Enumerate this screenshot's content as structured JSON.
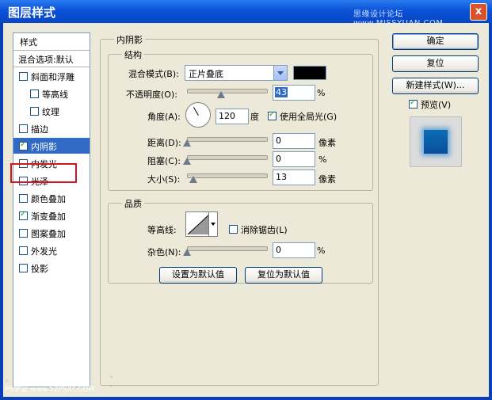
{
  "window": {
    "title": "图层样式",
    "watermark": "思缘设计论坛 www.MISSYUAN.COM",
    "close_symbol": "x"
  },
  "left_panel": {
    "header": "样式",
    "blend_options": "混合选项:默认",
    "items": [
      {
        "label": "斜面和浮雕",
        "checked": false,
        "indent": false
      },
      {
        "label": "等高线",
        "checked": false,
        "indent": true
      },
      {
        "label": "纹理",
        "checked": false,
        "indent": true
      },
      {
        "label": "描边",
        "checked": false,
        "indent": false
      },
      {
        "label": "内阴影",
        "checked": true,
        "indent": false,
        "selected": true
      },
      {
        "label": "内发光",
        "checked": false,
        "indent": false
      },
      {
        "label": "光泽",
        "checked": false,
        "indent": false
      },
      {
        "label": "颜色叠加",
        "checked": false,
        "indent": false
      },
      {
        "label": "渐变叠加",
        "checked": true,
        "indent": false
      },
      {
        "label": "图案叠加",
        "checked": false,
        "indent": false
      },
      {
        "label": "外发光",
        "checked": false,
        "indent": false
      },
      {
        "label": "投影",
        "checked": false,
        "indent": false
      }
    ]
  },
  "inner_shadow": {
    "section_title": "内阴影",
    "structure": {
      "title": "结构",
      "blend_mode_label": "混合模式(B):",
      "blend_mode_value": "正片叠底",
      "shadow_color": "#000000",
      "opacity_label": "不透明度(O):",
      "opacity_value": "43",
      "opacity_unit": "%",
      "angle_label": "角度(A):",
      "angle_value": "120",
      "angle_unit": "度",
      "global_light_label": "使用全局光(G)",
      "global_light_checked": true,
      "distance_label": "距离(D):",
      "distance_value": "0",
      "distance_unit": "像素",
      "choke_label": "阻塞(C):",
      "choke_value": "0",
      "choke_unit": "%",
      "size_label": "大小(S):",
      "size_value": "13",
      "size_unit": "像素"
    },
    "quality": {
      "title": "品质",
      "contour_label": "等高线:",
      "anti_alias_label": "消除锯齿(L)",
      "anti_alias_checked": false,
      "noise_label": "杂色(N):",
      "noise_value": "0",
      "noise_unit": "%"
    },
    "set_default_button": "设置为默认值",
    "reset_default_button": "复位为默认值"
  },
  "right_panel": {
    "ok_button": "确定",
    "reset_button": "复位",
    "new_style_button": "新建样式(W)...",
    "preview_label": "预览(V)",
    "preview_checked": true
  },
  "footer": {
    "mark": "PS学堂 www.52PSXT.COM"
  }
}
